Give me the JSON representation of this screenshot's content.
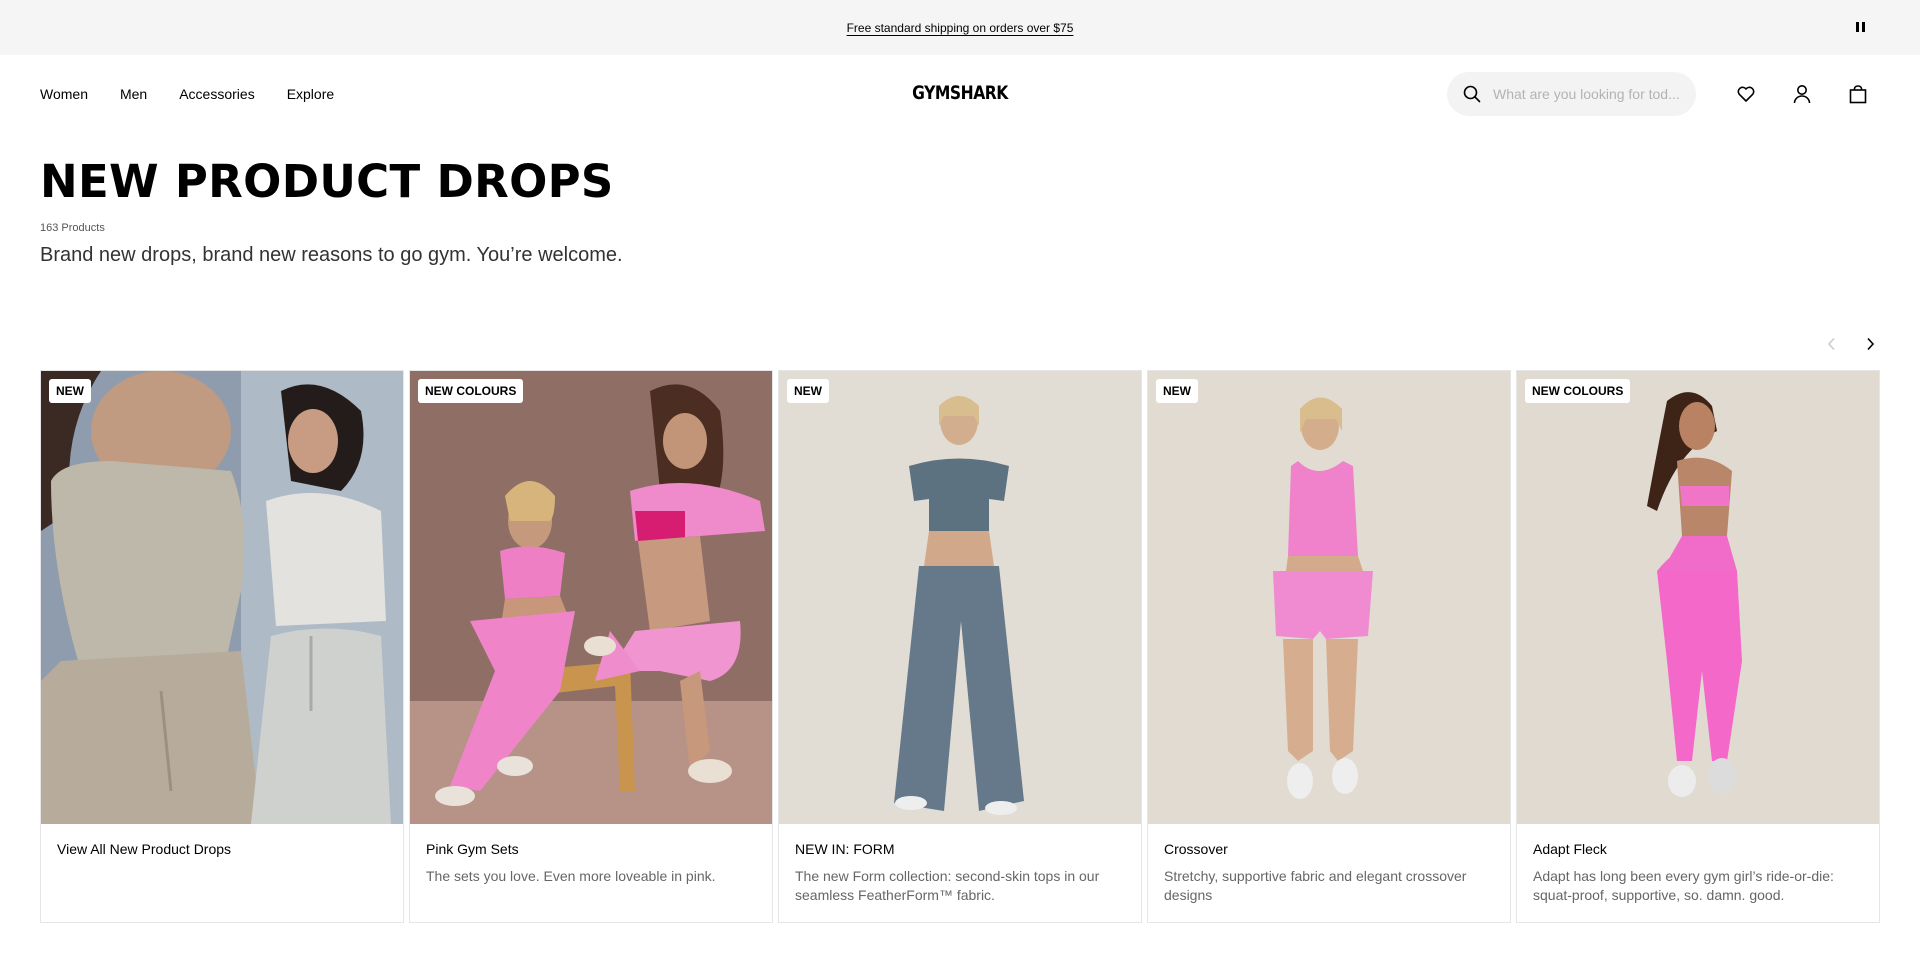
{
  "announcement": {
    "text": "Free standard shipping on orders over $75"
  },
  "header": {
    "nav": [
      "Women",
      "Men",
      "Accessories",
      "Explore"
    ],
    "logo": "GYMSHARK",
    "search_placeholder": "What are you looking for tod..."
  },
  "hero": {
    "title": "NEW PRODUCT DROPS",
    "count": "163 Products",
    "tagline": "Brand new drops, brand new reasons to go gym. You’re welcome."
  },
  "cards": [
    {
      "badge": "NEW",
      "title": "View All New Product Drops",
      "desc": ""
    },
    {
      "badge": "NEW COLOURS",
      "title": "Pink Gym Sets",
      "desc": "The sets you love. Even more loveable in pink."
    },
    {
      "badge": "NEW",
      "title": "NEW IN: FORM",
      "desc": "The new Form collection: second-skin tops in our seamless FeatherForm™ fabric."
    },
    {
      "badge": "NEW",
      "title": "Crossover",
      "desc": "Stretchy, supportive fabric and elegant crossover designs"
    },
    {
      "badge": "NEW COLOURS",
      "title": "Adapt Fleck",
      "desc": "Adapt has long been every gym girl’s ride-or-die: squat-proof, supportive, so. damn. good."
    }
  ],
  "icons": [
    "pause-icon",
    "search-icon",
    "heart-icon",
    "account-icon",
    "bag-icon",
    "chevron-left-icon",
    "chevron-right-icon"
  ],
  "colors": {
    "announce_bg": "#f5f5f5",
    "search_bg": "#f3f3f3",
    "pink": "#f27fc6"
  }
}
